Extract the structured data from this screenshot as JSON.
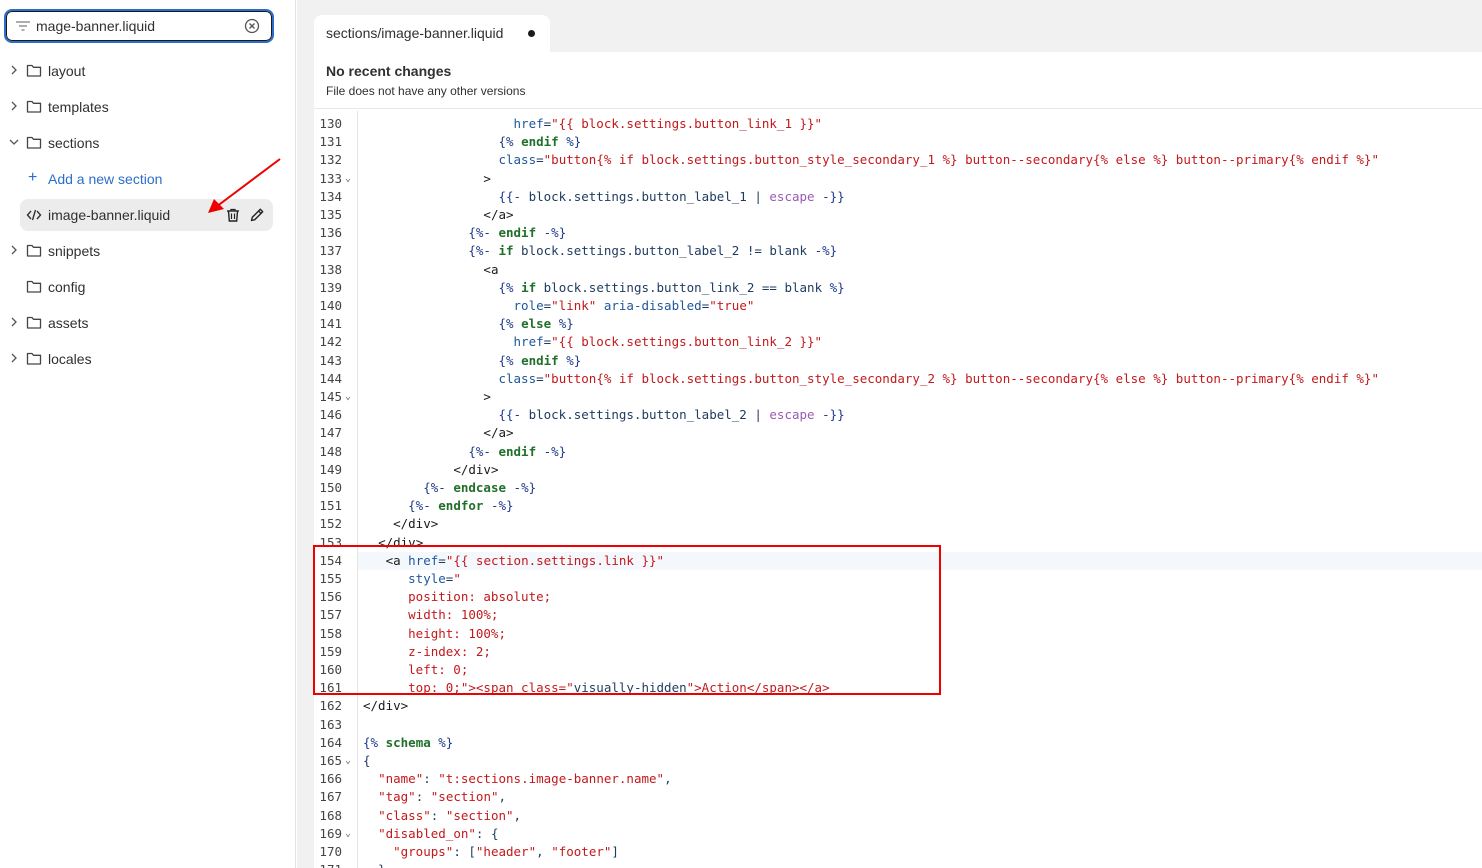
{
  "search": {
    "value": "mage-banner.liquid"
  },
  "tree": {
    "items": [
      {
        "label": "layout",
        "chevron": "right"
      },
      {
        "label": "templates",
        "chevron": "right"
      },
      {
        "label": "sections",
        "chevron": "down"
      },
      {
        "label": "Add a new section",
        "kind": "add"
      },
      {
        "label": "image-banner.liquid",
        "kind": "file"
      },
      {
        "label": "snippets",
        "chevron": "right"
      },
      {
        "label": "config",
        "chevron": "none"
      },
      {
        "label": "assets",
        "chevron": "right"
      },
      {
        "label": "locales",
        "chevron": "right"
      }
    ]
  },
  "editor": {
    "tab": {
      "path_prefix": "sections/",
      "file_name": "image-banner.liquid"
    },
    "recent": {
      "title": "No recent changes",
      "subtitle": "File does not have any other versions"
    },
    "active_line": 154,
    "lines": [
      {
        "n": "130",
        "code": "                    href=\"{{ block.settings.button_link_1 }}\""
      },
      {
        "n": "131",
        "code": "                  {% endif %}"
      },
      {
        "n": "132",
        "code": "                  class=\"button{% if block.settings.button_style_secondary_1 %} button--secondary{% else %} button--primary{% endif %}\""
      },
      {
        "n": "133",
        "code": "                >",
        "fold": true
      },
      {
        "n": "134",
        "code": "                  {{- block.settings.button_label_1 | escape -}}"
      },
      {
        "n": "135",
        "code": "                </a>"
      },
      {
        "n": "136",
        "code": "              {%- endif -%}"
      },
      {
        "n": "137",
        "code": "              {%- if block.settings.button_label_2 != blank -%}"
      },
      {
        "n": "138",
        "code": "                <a"
      },
      {
        "n": "139",
        "code": "                  {% if block.settings.button_link_2 == blank %}"
      },
      {
        "n": "140",
        "code": "                    role=\"link\" aria-disabled=\"true\""
      },
      {
        "n": "141",
        "code": "                  {% else %}"
      },
      {
        "n": "142",
        "code": "                    href=\"{{ block.settings.button_link_2 }}\""
      },
      {
        "n": "143",
        "code": "                  {% endif %}"
      },
      {
        "n": "144",
        "code": "                  class=\"button{% if block.settings.button_style_secondary_2 %} button--secondary{% else %} button--primary{% endif %}\""
      },
      {
        "n": "145",
        "code": "                >",
        "fold": true
      },
      {
        "n": "146",
        "code": "                  {{- block.settings.button_label_2 | escape -}}"
      },
      {
        "n": "147",
        "code": "                </a>"
      },
      {
        "n": "148",
        "code": "              {%- endif -%}"
      },
      {
        "n": "149",
        "code": "            </div>"
      },
      {
        "n": "150",
        "code": "        {%- endcase -%}"
      },
      {
        "n": "151",
        "code": "      {%- endfor -%}"
      },
      {
        "n": "152",
        "code": "    </div>"
      },
      {
        "n": "153",
        "code": "  </div>"
      },
      {
        "n": "154",
        "code": "   <a href=\"{{ section.settings.link }}\""
      },
      {
        "n": "155",
        "code": "      style=\""
      },
      {
        "n": "156",
        "code": "      position: absolute;"
      },
      {
        "n": "157",
        "code": "      width: 100%;"
      },
      {
        "n": "158",
        "code": "      height: 100%;"
      },
      {
        "n": "159",
        "code": "      z-index: 2;"
      },
      {
        "n": "160",
        "code": "      left: 0;"
      },
      {
        "n": "161",
        "code": "      top: 0;\"><span class=\"visually-hidden\">Action</span></a>"
      },
      {
        "n": "162",
        "code": "</div>"
      },
      {
        "n": "163",
        "code": ""
      },
      {
        "n": "164",
        "code": "{% schema %}"
      },
      {
        "n": "165",
        "code": "{",
        "fold": true
      },
      {
        "n": "166",
        "code": "  \"name\": \"t:sections.image-banner.name\","
      },
      {
        "n": "167",
        "code": "  \"tag\": \"section\","
      },
      {
        "n": "168",
        "code": "  \"class\": \"section\","
      },
      {
        "n": "169",
        "code": "  \"disabled_on\": {",
        "fold": true
      },
      {
        "n": "170",
        "code": "    \"groups\": [\"header\", \"footer\"]"
      },
      {
        "n": "171",
        "code": "  },"
      }
    ]
  },
  "colors": {
    "accent": "#2c6ecb",
    "annotation": "#e00000"
  }
}
